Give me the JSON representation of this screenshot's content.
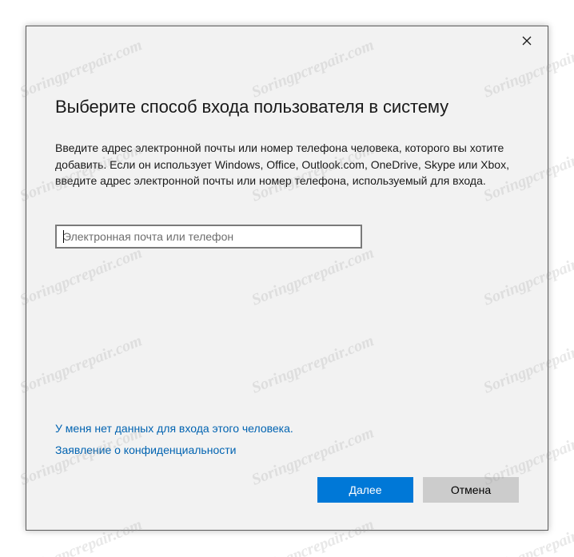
{
  "dialog": {
    "close_glyph": "✕",
    "title": "Выберите способ входа пользователя в систему",
    "description": "Введите адрес электронной почты или номер телефона человека, которого вы хотите добавить. Если он использует Windows, Office, Outlook.com, OneDrive, Skype или Xbox, введите адрес электронной почты или номер телефона, используемый для входа.",
    "input": {
      "placeholder": "Электронная почта или телефон",
      "value": ""
    },
    "links": {
      "no_info": "У меня нет данных для входа этого человека.",
      "privacy": "Заявление о конфиденциальности"
    },
    "buttons": {
      "next": "Далее",
      "cancel": "Отмена"
    }
  },
  "watermark_text": "Soringpcrepair.com",
  "colors": {
    "accent": "#0078d7",
    "link": "#0063b1",
    "dialog_bg": "#f2f2f2",
    "cancel_bg": "#cccccc"
  }
}
